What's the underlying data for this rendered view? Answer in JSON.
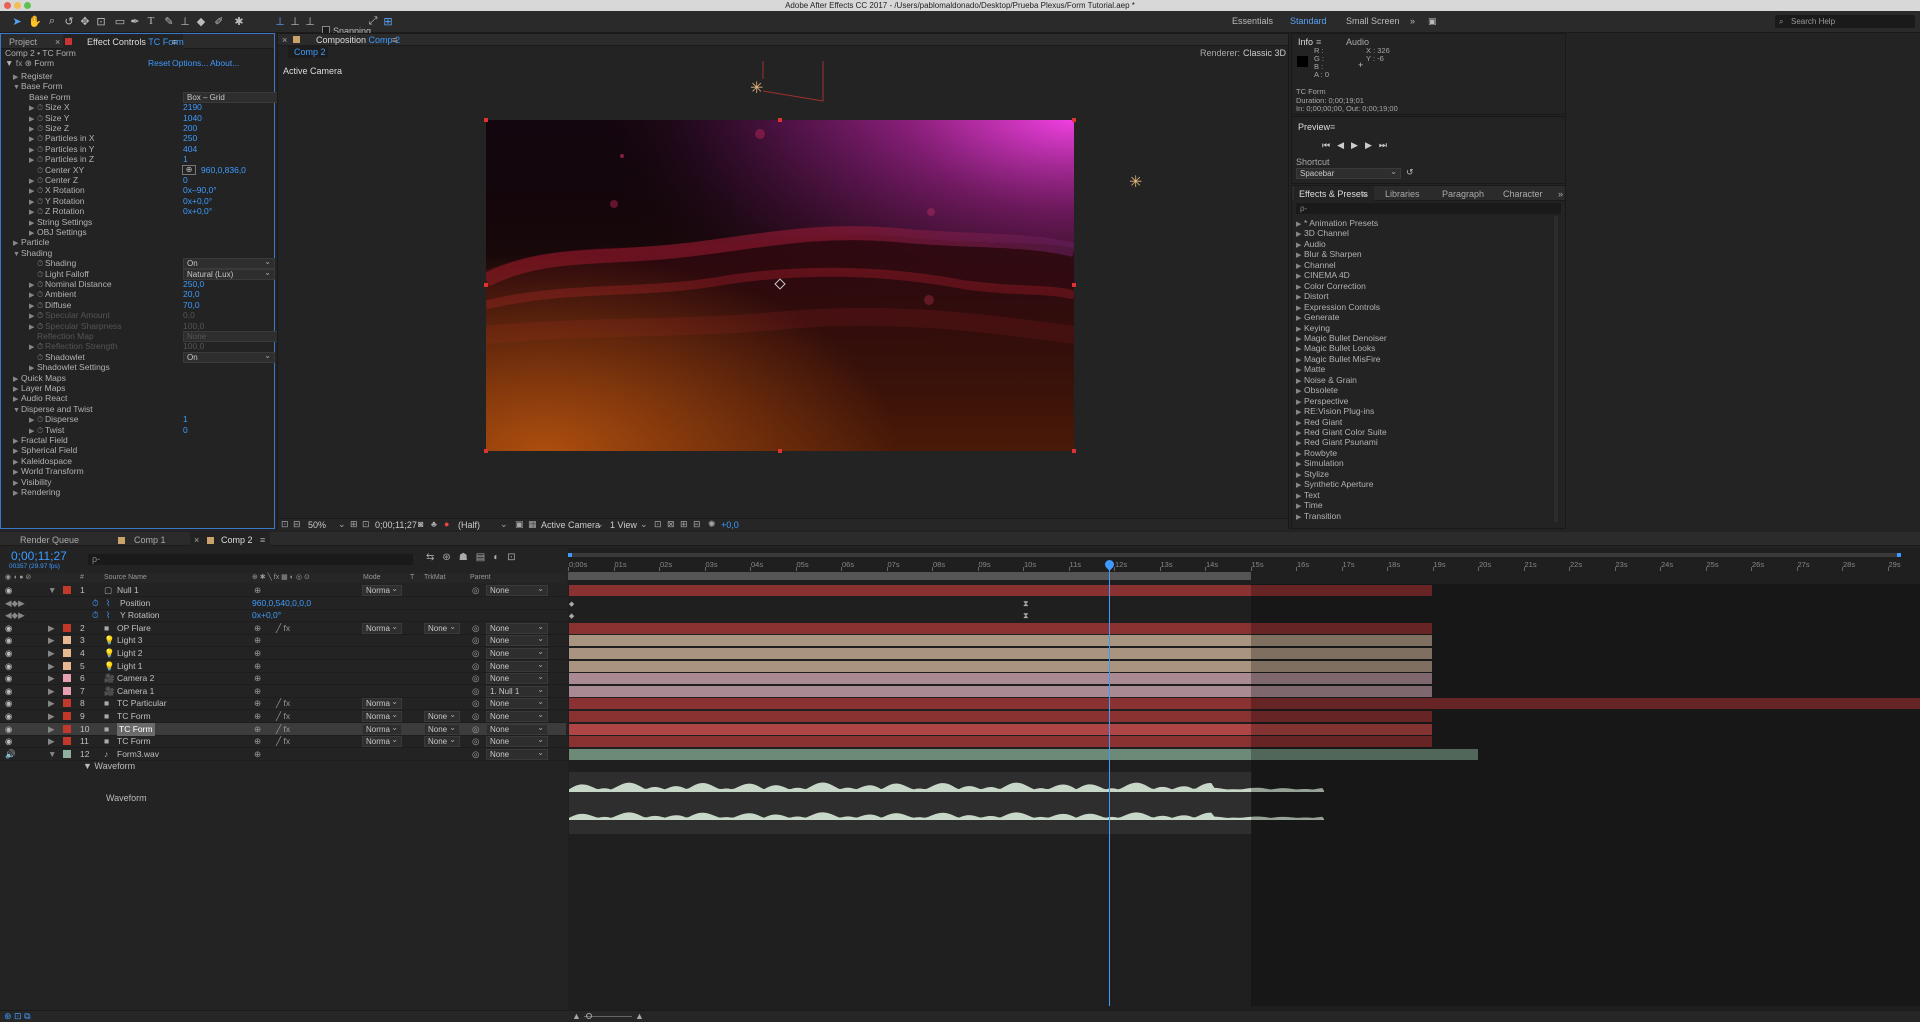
{
  "app": {
    "title": "Adobe After Effects CC 2017 - /Users/pablomaldonado/Desktop/Prueba Plexus/Form Tutorial.aep *"
  },
  "toolbar": {
    "snapping": "Snapping",
    "workspaces": [
      "Essentials",
      "Standard",
      "Small Screen"
    ],
    "active_workspace": "Standard",
    "search": "Search Help"
  },
  "project_panel": {
    "tab_project": "Project",
    "tab_effect_controls": "Effect Controls",
    "effect_layer": "TC Form",
    "breadcrumb": "Comp 2 • TC Form",
    "effect_name": "Form",
    "reset": "Reset",
    "options": "Options...",
    "about": "About..."
  },
  "effect_props": [
    {
      "label": "Register",
      "indent": 1,
      "tri": "▶"
    },
    {
      "label": "Base Form",
      "indent": 1,
      "tri": "▼"
    },
    {
      "label": "Base Form",
      "indent": 2,
      "dd": "Box – Grid"
    },
    {
      "label": "Size X",
      "indent": 3,
      "tri": "▶",
      "sw": true,
      "value": "2190"
    },
    {
      "label": "Size Y",
      "indent": 3,
      "tri": "▶",
      "sw": true,
      "value": "1040"
    },
    {
      "label": "Size Z",
      "indent": 3,
      "tri": "▶",
      "sw": true,
      "value": "200"
    },
    {
      "label": "Particles in X",
      "indent": 3,
      "tri": "▶",
      "sw": true,
      "value": "250"
    },
    {
      "label": "Particles in Y",
      "indent": 3,
      "tri": "▶",
      "sw": true,
      "value": "404"
    },
    {
      "label": "Particles in Z",
      "indent": 3,
      "tri": "▶",
      "sw": true,
      "value": "1"
    },
    {
      "label": "Center XY",
      "indent": 3,
      "sw": true,
      "value": "960,0,836,0",
      "cross": true
    },
    {
      "label": "Center Z",
      "indent": 3,
      "tri": "▶",
      "sw": true,
      "value": "0"
    },
    {
      "label": "X Rotation",
      "indent": 3,
      "tri": "▶",
      "sw": true,
      "value": "0x–90,0°"
    },
    {
      "label": "Y Rotation",
      "indent": 3,
      "tri": "▶",
      "sw": true,
      "value": "0x+0,0°"
    },
    {
      "label": "Z Rotation",
      "indent": 3,
      "tri": "▶",
      "sw": true,
      "value": "0x+0,0°"
    },
    {
      "label": "String Settings",
      "indent": 3,
      "tri": "▶"
    },
    {
      "label": "OBJ Settings",
      "indent": 3,
      "tri": "▶"
    },
    {
      "label": "Particle",
      "indent": 1,
      "tri": "▶"
    },
    {
      "label": "Shading",
      "indent": 1,
      "tri": "▼"
    },
    {
      "label": "Shading",
      "indent": 3,
      "sw": true,
      "dd": "On"
    },
    {
      "label": "Light Falloff",
      "indent": 3,
      "sw": true,
      "dd": "Natural (Lux)"
    },
    {
      "label": "Nominal Distance",
      "indent": 3,
      "tri": "▶",
      "sw": true,
      "value": "250,0"
    },
    {
      "label": "Ambient",
      "indent": 3,
      "tri": "▶",
      "sw": true,
      "value": "20,0"
    },
    {
      "label": "Diffuse",
      "indent": 3,
      "tri": "▶",
      "sw": true,
      "value": "70,0"
    },
    {
      "label": "Specular Amount",
      "indent": 3,
      "tri": "▶",
      "sw": true,
      "value": "0,0",
      "dim": true
    },
    {
      "label": "Specular Sharpness",
      "indent": 3,
      "tri": "▶",
      "sw": true,
      "value": "100,0",
      "dim": true
    },
    {
      "label": "Reflection Map",
      "indent": 3,
      "dd": "None",
      "dim": true
    },
    {
      "label": "Reflection Strength",
      "indent": 3,
      "tri": "▶",
      "sw": true,
      "value": "100,0",
      "dim": true
    },
    {
      "label": "Shadowlet",
      "indent": 3,
      "sw": true,
      "dd": "On"
    },
    {
      "label": "Shadowlet Settings",
      "indent": 3,
      "tri": "▶"
    },
    {
      "label": "Quick Maps",
      "indent": 1,
      "tri": "▶"
    },
    {
      "label": "Layer Maps",
      "indent": 1,
      "tri": "▶"
    },
    {
      "label": "Audio React",
      "indent": 1,
      "tri": "▶"
    },
    {
      "label": "Disperse and Twist",
      "indent": 1,
      "tri": "▼"
    },
    {
      "label": "Disperse",
      "indent": 3,
      "tri": "▶",
      "sw": true,
      "value": "1"
    },
    {
      "label": "Twist",
      "indent": 3,
      "tri": "▶",
      "sw": true,
      "value": "0"
    },
    {
      "label": "Fractal Field",
      "indent": 1,
      "tri": "▶"
    },
    {
      "label": "Spherical Field",
      "indent": 1,
      "tri": "▶"
    },
    {
      "label": "Kaleidospace",
      "indent": 1,
      "tri": "▶"
    },
    {
      "label": "World Transform",
      "indent": 1,
      "tri": "▶"
    },
    {
      "label": "Visibility",
      "indent": 1,
      "tri": "▶"
    },
    {
      "label": "Rendering",
      "indent": 1,
      "tri": "▶"
    }
  ],
  "comp_panel": {
    "tab": "Composition",
    "comp_name": "Comp 2",
    "subtab": "Comp 2",
    "renderer_label": "Renderer:",
    "renderer": "Classic 3D",
    "view_label": "Active Camera"
  },
  "viewer_bar": {
    "zoom": "50%",
    "timecode": "0;00;11;27",
    "resolution": "(Half)",
    "camera": "Active Camera",
    "views": "1 View",
    "exposure": "+0,0"
  },
  "info_panel": {
    "tab_info": "Info",
    "tab_audio": "Audio",
    "r": "R :",
    "g": "G :",
    "b": "B :",
    "a": "A : 0",
    "x": "X : 326",
    "y": "Y : -6",
    "layer": "TC Form",
    "duration": "Duration: 0;00;19;01",
    "in_out": "In: 0;00;00;00, Out: 0;00;19;00"
  },
  "preview_panel": {
    "tab": "Preview",
    "shortcut_label": "Shortcut",
    "shortcut": "Spacebar"
  },
  "effects_panel": {
    "tabs": [
      "Effects & Presets",
      "Libraries",
      "Paragraph",
      "Character"
    ],
    "search_placeholder": "ρ-",
    "items": [
      "* Animation Presets",
      "3D Channel",
      "Audio",
      "Blur & Sharpen",
      "Channel",
      "CINEMA 4D",
      "Color Correction",
      "Distort",
      "Expression Controls",
      "Generate",
      "Keying",
      "Magic Bullet Denoiser",
      "Magic Bullet Looks",
      "Magic Bullet MisFire",
      "Matte",
      "Noise & Grain",
      "Obsolete",
      "Perspective",
      "RE:Vision Plug-ins",
      "Red Giant",
      "Red Giant Color Suite",
      "Red Giant Psunami",
      "Rowbyte",
      "Simulation",
      "Stylize",
      "Synthetic Aperture",
      "Text",
      "Time",
      "Transition"
    ]
  },
  "timeline": {
    "tabs": [
      "Render Queue",
      "Comp 1",
      "Comp 2"
    ],
    "timecode": "0;00;11;27",
    "frames": "00357 (29.97 fps)",
    "search_placeholder": "ρ-",
    "headers": {
      "hash": "#",
      "source": "Source Name",
      "mode": "Mode",
      "t": "T",
      "trkmat": "TrkMat",
      "parent": "Parent"
    },
    "ruler": [
      "0;00s",
      "01s",
      "02s",
      "03s",
      "04s",
      "05s",
      "06s",
      "07s",
      "08s",
      "09s",
      "10s",
      "11s",
      "12s",
      "13s",
      "14s",
      "15s",
      "16s",
      "17s",
      "18s",
      "19s",
      "20s",
      "21s",
      "22s",
      "23s",
      "24s",
      "25s",
      "26s",
      "27s",
      "28s",
      "29s"
    ],
    "layers": [
      {
        "num": "1",
        "name": "Null 1",
        "color": "#c0392b",
        "mode": "Norma",
        "parent": "None",
        "type": "null",
        "expanded": true,
        "bar": "#8a3131",
        "bar_end": 19.0
      },
      {
        "sub": true,
        "name": "Position",
        "value": "960,0,540,0,0,0"
      },
      {
        "sub": true,
        "name": "Y Rotation",
        "value": "0x+0,0°"
      },
      {
        "num": "2",
        "name": "OP Flare",
        "color": "#c0392b",
        "mode": "Norma",
        "trk": "None",
        "parent": "None",
        "bar": "#8a3131",
        "bar_end": 19.0,
        "fx": true
      },
      {
        "num": "3",
        "name": "Light 3",
        "color": "#e8b890",
        "parent": "None",
        "type": "light",
        "bar": "#a99480",
        "bar_end": 19.0
      },
      {
        "num": "4",
        "name": "Light 2",
        "color": "#e8b890",
        "parent": "None",
        "type": "light",
        "bar": "#a99480",
        "bar_end": 19.0
      },
      {
        "num": "5",
        "name": "Light 1",
        "color": "#e8b890",
        "parent": "None",
        "type": "light",
        "bar": "#a99480",
        "bar_end": 19.0
      },
      {
        "num": "6",
        "name": "Camera 2",
        "color": "#e8a0b0",
        "parent": "None",
        "type": "cam",
        "bar": "#a98a92",
        "bar_end": 19.0
      },
      {
        "num": "7",
        "name": "Camera 1",
        "color": "#e8a0b0",
        "parent": "1. Null 1",
        "type": "cam",
        "bar": "#a98a92",
        "bar_end": 19.0
      },
      {
        "num": "8",
        "name": "TC Particular",
        "color": "#c0392b",
        "mode": "Norma",
        "parent": "None",
        "bar": "#8a3131",
        "bar_end": 29.9,
        "fx": true
      },
      {
        "num": "9",
        "name": "TC Form",
        "color": "#c0392b",
        "mode": "Norma",
        "trk": "None",
        "parent": "None",
        "bar": "#8a3131",
        "bar_end": 19.0,
        "fx": true
      },
      {
        "num": "10",
        "name": "TC Form",
        "color": "#c0392b",
        "mode": "Norma",
        "trk": "None",
        "parent": "None",
        "bar": "#b04545",
        "bar_end": 19.0,
        "fx": true,
        "selected": true
      },
      {
        "num": "11",
        "name": "TC Form",
        "color": "#c0392b",
        "mode": "Norma",
        "trk": "None",
        "parent": "None",
        "bar": "#8a3131",
        "bar_end": 19.0,
        "fx": true
      },
      {
        "num": "12",
        "name": "Form3.wav",
        "color": "#8fb0a0",
        "parent": "None",
        "type": "audio",
        "expanded": true,
        "bar": "#6d8a78",
        "bar_end": 20.0
      }
    ],
    "waveform_group": "Waveform",
    "waveform_label": "Waveform",
    "playhead_sec": 11.9,
    "work_area_end_sec": 15.0
  }
}
